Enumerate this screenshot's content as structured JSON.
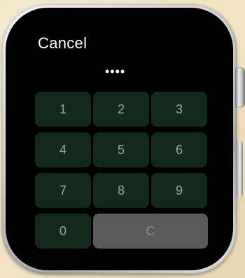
{
  "cancel_label": "Cancel",
  "passcode_dots": "••••",
  "keypad": {
    "k1": "1",
    "k2": "2",
    "k3": "3",
    "k4": "4",
    "k5": "5",
    "k6": "6",
    "k7": "7",
    "k8": "8",
    "k9": "9",
    "k0": "0",
    "clear": "C"
  },
  "colors": {
    "key_background": "#12291c",
    "clear_background": "#5a5a5a",
    "screen": "#000000",
    "text": "#ffffff"
  }
}
